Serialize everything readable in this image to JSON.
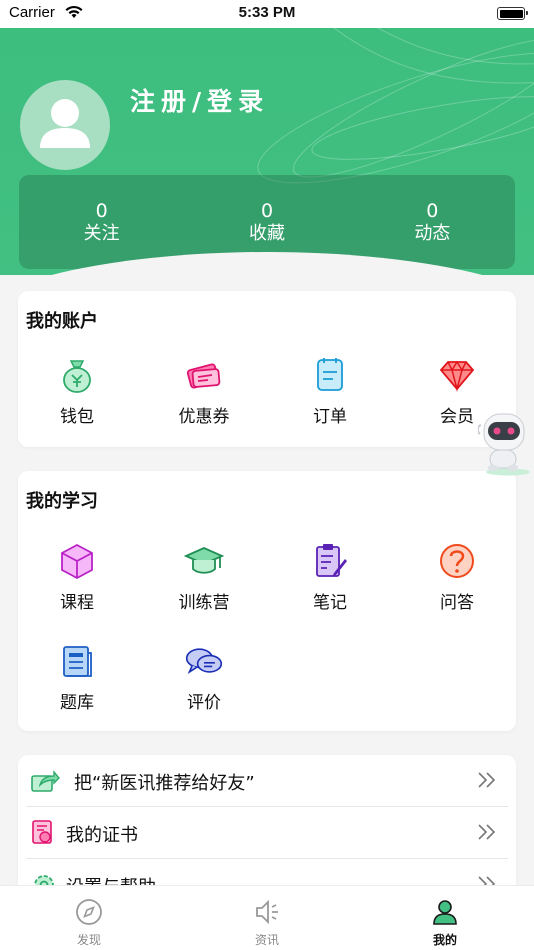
{
  "status_bar": {
    "carrier": "Carrier",
    "time": "5:33 PM"
  },
  "header": {
    "login_label": "注册/登录"
  },
  "stats": [
    {
      "value": "0",
      "label": "关注"
    },
    {
      "value": "0",
      "label": "收藏"
    },
    {
      "value": "0",
      "label": "动态"
    }
  ],
  "account": {
    "title": "我的账户",
    "items": [
      {
        "label": "钱包",
        "icon": "wallet-icon"
      },
      {
        "label": "优惠券",
        "icon": "coupon-icon"
      },
      {
        "label": "订单",
        "icon": "order-icon"
      },
      {
        "label": "会员",
        "icon": "diamond-icon"
      }
    ]
  },
  "learning": {
    "title": "我的学习",
    "items": [
      {
        "label": "课程",
        "icon": "cube-icon"
      },
      {
        "label": "训练营",
        "icon": "graduation-cap-icon"
      },
      {
        "label": "笔记",
        "icon": "notes-icon"
      },
      {
        "label": "问答",
        "icon": "question-icon"
      },
      {
        "label": "题库",
        "icon": "question-bank-icon"
      },
      {
        "label": "评价",
        "icon": "chat-bubbles-icon"
      }
    ]
  },
  "menu": [
    {
      "label": "把“新医讯推荐给好友”",
      "icon": "share-icon"
    },
    {
      "label": "我的证书",
      "icon": "certificate-icon"
    },
    {
      "label": "设置与帮助",
      "icon": "settings-icon"
    }
  ],
  "tabs": [
    {
      "label": "发现",
      "icon": "compass-icon",
      "active": false
    },
    {
      "label": "资讯",
      "icon": "speaker-icon",
      "active": false
    },
    {
      "label": "我的",
      "icon": "person-icon",
      "active": true
    }
  ],
  "colors": {
    "brand_green": "#42c083",
    "background": "#f4f4f4"
  }
}
